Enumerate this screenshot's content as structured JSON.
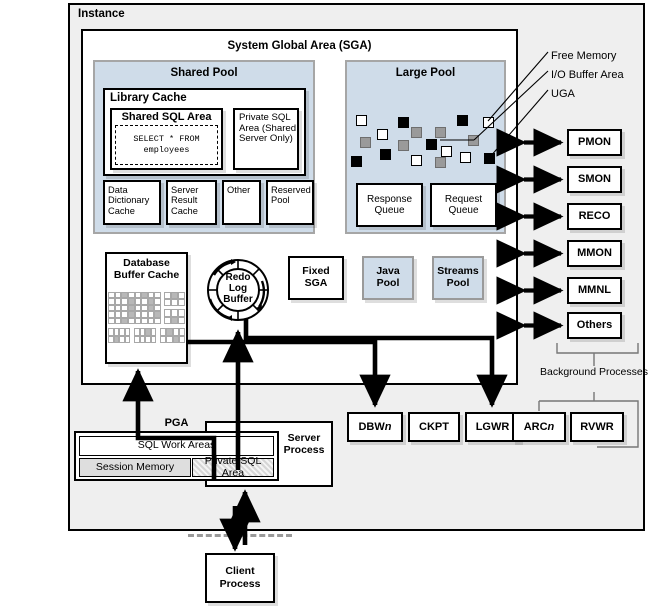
{
  "diagram": {
    "instance_label": "Instance",
    "sga_title": "System Global Area (SGA)",
    "shared_pool": {
      "title": "Shared Pool",
      "library_cache_title": "Library Cache",
      "shared_sql_area_title": "Shared SQL Area",
      "sql_line1": "SELECT * FROM",
      "sql_line2": "employees",
      "private_sql_area": "Private SQL Area (Shared Server Only)",
      "sub_boxes": [
        "Data Dictionary Cache",
        "Server Result Cache",
        "Other",
        "Reserved Pool"
      ]
    },
    "large_pool": {
      "title": "Large Pool",
      "queues": [
        "Response Queue",
        "Request Queue"
      ],
      "legend": [
        "Free Memory",
        "I/O Buffer Area",
        "UGA"
      ]
    },
    "buffer_cache": {
      "line1": "Database",
      "line2": "Buffer Cache"
    },
    "redo_log_buffer": {
      "line1": "Redo",
      "line2": "Log",
      "line3": "Buffer"
    },
    "fixed_sga": "Fixed SGA",
    "mid_pools": [
      "Java Pool",
      "Streams Pool"
    ],
    "background_processes": {
      "bracket_label": "Background Processes",
      "items": [
        "PMON",
        "SMON",
        "RECO",
        "MMON",
        "MMNL",
        "Others"
      ]
    },
    "pga": {
      "title": "PGA",
      "sql_work_areas": "SQL Work Areas",
      "session_memory": "Session Memory",
      "private_sql_area": "Private SQL Area"
    },
    "server_process": "Server Process",
    "bottom_processes": [
      "DBWn",
      "CKPT",
      "LGWR",
      "ARCn",
      "RVWR"
    ],
    "client_process": {
      "line1": "Client",
      "line2": "Process"
    },
    "colors": {
      "pool_fill": "#cfdce9",
      "instance_fill": "#efefef",
      "io_buffer": "#9a9a9a",
      "uga": "#000000",
      "free_memory": "#ffffff"
    }
  }
}
